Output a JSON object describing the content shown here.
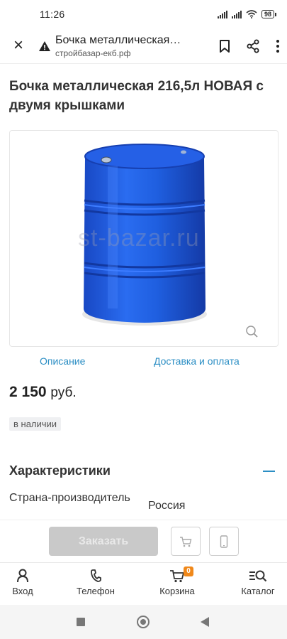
{
  "status_bar": {
    "time": "11:26",
    "battery": "98"
  },
  "browser": {
    "page_title": "Бочка металлическая 216,5л НОВАЯ с двумя крышками",
    "domain": "стройбазар-екб.рф",
    "icons": [
      "close-icon",
      "warning-icon",
      "bookmark-icon",
      "share-icon",
      "more-icon"
    ]
  },
  "product": {
    "title": "Бочка металлическая 216,5л НОВАЯ с двумя крышками",
    "image_watermark": "st-bazar.ru",
    "price_amount": "2 150",
    "price_currency": "руб.",
    "stock_status": "в наличии"
  },
  "tabs": {
    "description": "Описание",
    "delivery": "Доставка и оплата"
  },
  "characteristics": {
    "title": "Характеристики",
    "rows": [
      {
        "name": "Страна-производитель",
        "value": "Россия"
      }
    ]
  },
  "order_bar": {
    "order_label": "Заказать"
  },
  "bottom_nav": {
    "login": "Вход",
    "phone": "Телефон",
    "cart": "Корзина",
    "cart_count": "0",
    "catalog": "Каталог"
  },
  "colors": {
    "accent": "#2b8ec4",
    "barrel": "#1f5fe0",
    "badge": "#f0881a",
    "disabled_button": "#c9c9c9"
  }
}
